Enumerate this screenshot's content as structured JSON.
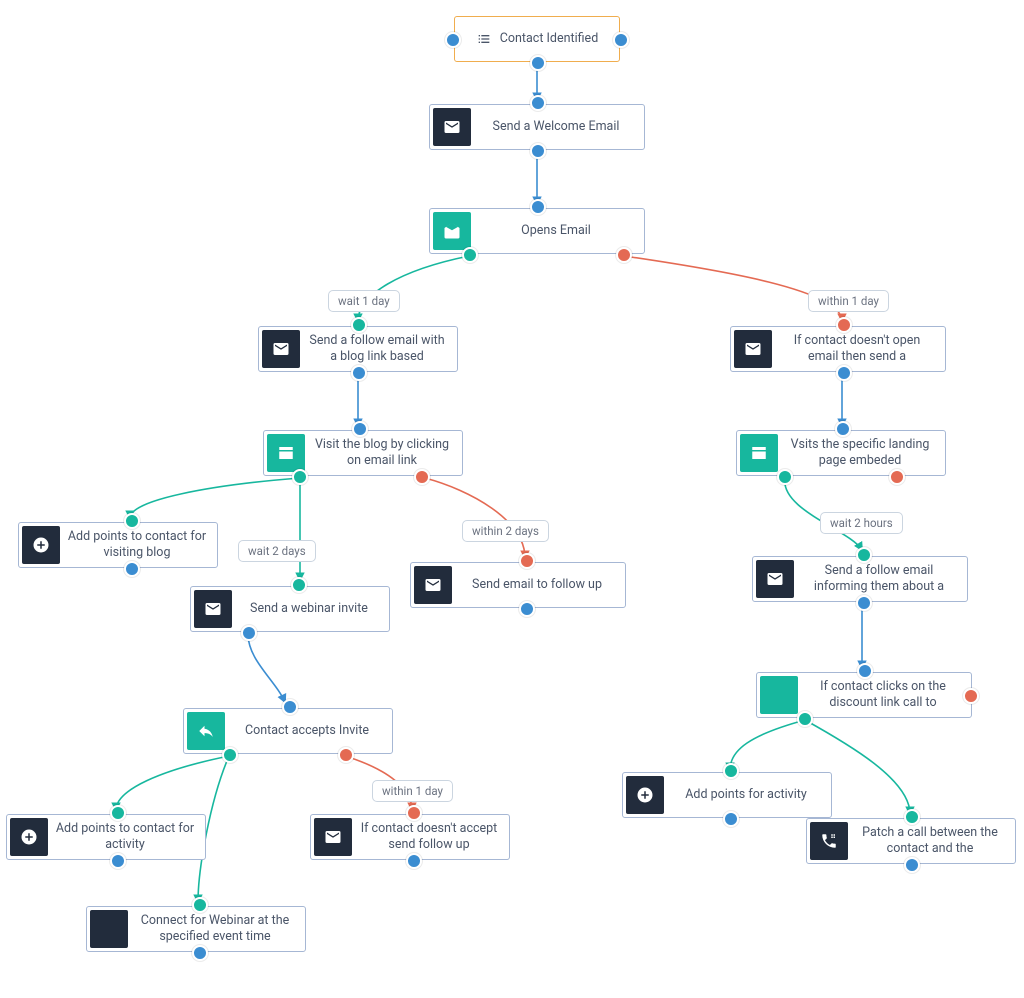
{
  "colors": {
    "blue": "#3b8dd1",
    "teal": "#17b79e",
    "red": "#e46a53",
    "orange_border": "#f0ad4e",
    "dark": "#222c3c"
  },
  "nodes": {
    "root": {
      "label": "Contact Identified"
    },
    "welcome": {
      "label": "Send a Welcome Email"
    },
    "opens": {
      "label": "Opens Email"
    },
    "follow_blog": {
      "label": "Send a follow email with a blog link based"
    },
    "visit_blog": {
      "label": "Visit the blog by clicking on email link"
    },
    "points_blog": {
      "label": "Add points to contact for visiting blog"
    },
    "webinar_invite": {
      "label": "Send a webinar invite"
    },
    "followup_noblog": {
      "label": "Send email to follow up"
    },
    "accept_invite": {
      "label": "Contact accepts Invite"
    },
    "points_activity": {
      "label": "Add points to contact for activity"
    },
    "followup_decline": {
      "label": "If contact doesn't accept send follow up"
    },
    "connect_webinar": {
      "label": "Connect for Webinar at the specified event time"
    },
    "noopen_send": {
      "label": "If contact doesn't open email then send a"
    },
    "visits_landing": {
      "label": "Vsits the specific landing page embeded"
    },
    "follow_discount": {
      "label": "Send a follow email informing them about a"
    },
    "clicks_discount": {
      "label": "If contact clicks on the discount link call to"
    },
    "points_discount": {
      "label": "Add points for activity"
    },
    "patch_call": {
      "label": "Patch a call between the contact and the"
    }
  },
  "labels": {
    "wait1": "wait 1 day",
    "within1": "within 1 day",
    "wait2": "wait 2 days",
    "within2": "within 2 days",
    "wait2h": "wait 2 hours",
    "within1b": "within 1 day"
  }
}
